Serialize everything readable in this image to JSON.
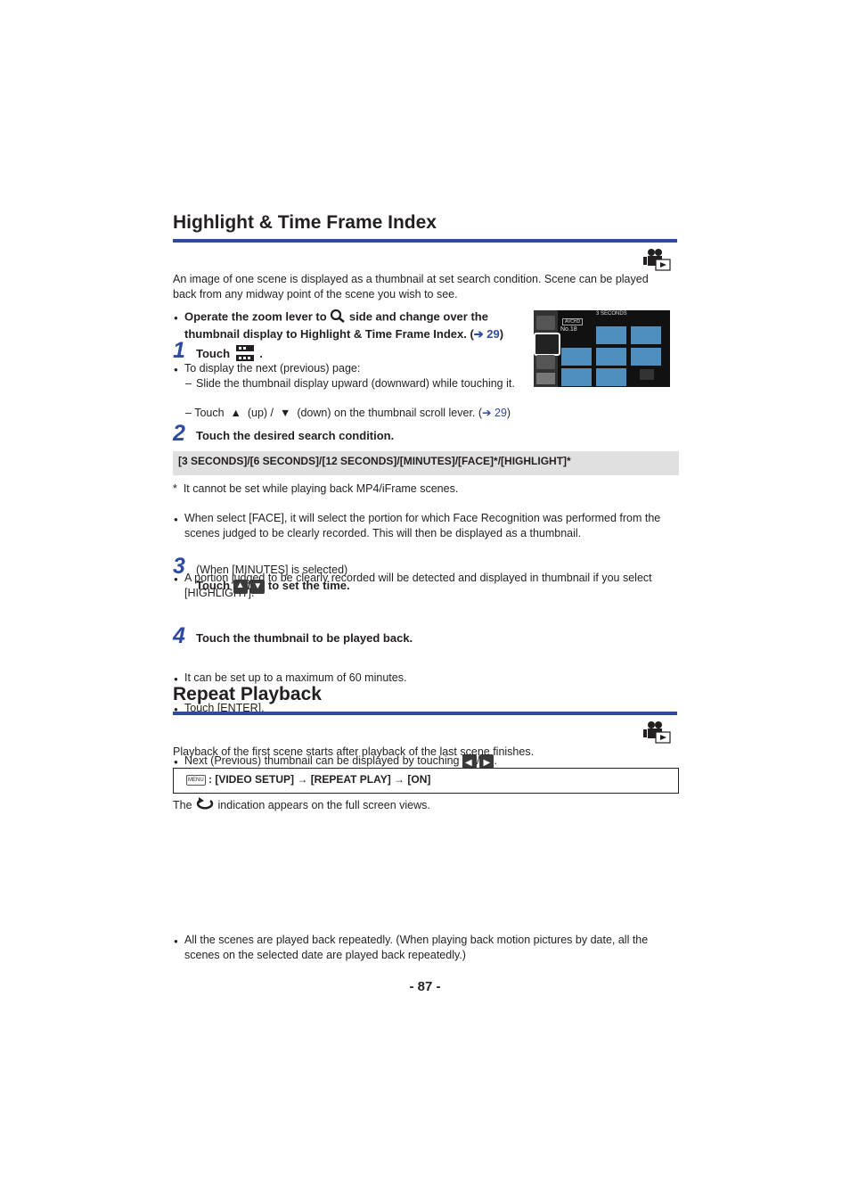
{
  "section1": {
    "title": "Highlight & Time Frame Index",
    "intro": "An image of one scene is displayed as a thumbnail at set search condition. Scene can be played back from any midway point of the scene you wish to see.",
    "prereq_a": "Operate the zoom lever to",
    "prereq_b": "side and change over the",
    "prereq_c": "thumbnail display to Highlight & Time Frame Index. (",
    "prereq_link": "➔ 29",
    "prereq_end": ")",
    "step1": {
      "num": "1",
      "label": "Touch",
      "end": "."
    },
    "step1_bullet": "To display the next (previous) page:",
    "step1_dash1": "Slide the thumbnail display upward (downward) while touching it.",
    "step1_dash2_a": "Touch",
    "step1_dash2_b": "(up) /",
    "step1_dash2_c": "(down) on the thumbnail scroll lever. (",
    "step1_dash2_link": "➔ 29",
    "step1_dash2_end": ")",
    "step2": {
      "num": "2",
      "label": "Touch the desired search condition."
    },
    "options_bar": "[3 SECONDS]/[6 SECONDS]/[12 SECONDS]/[MINUTES]/[FACE]*/[HIGHLIGHT]*",
    "note_star": "It cannot be set while playing back MP4/iFrame scenes.",
    "note1": "When select [FACE], it will select the portion for which Face Recognition was performed from the scenes judged to be clearly recorded. This will then be displayed as a thumbnail.",
    "note2": "A portion judged to be clearly recorded will be detected and displayed in thumbnail if you select [HIGHLIGHT].",
    "step3": {
      "num": "3",
      "sub": "(When [MINUTES] is selected)",
      "label_a": "Touch",
      "label_b": "/",
      "label_c": "to set the time."
    },
    "step3_b1": "It can be set up to a maximum of 60 minutes.",
    "step3_b2": "Touch [ENTER].",
    "step4": {
      "num": "4",
      "label": "Touch the thumbnail to be played back."
    },
    "step4_b1": "Next (Previous) thumbnail can be displayed by touching",
    "step4_b1_sep": "/",
    "step4_b1_end": ".",
    "screen": {
      "header": "3 SECONDS",
      "badge": "AVCHD",
      "scene_no": "No.18"
    }
  },
  "section2": {
    "title": "Repeat Playback",
    "intro": "Playback of the first scene starts after playback of the last scene finishes.",
    "menu_icon": "MENU",
    "menu_path": ": [VIDEO SETUP] → [REPEAT PLAY] → [ON]",
    "indication_a": "The",
    "indication_b": "indication appears on the full screen views.",
    "bullet1": "All the scenes are played back repeatedly. (When playing back motion pictures by date, all the scenes on the selected date are played back repeatedly.)"
  },
  "page_number": "- 87 -",
  "colors": {
    "accent": "#2e4ba0",
    "text": "#231f20",
    "gray_bar": "#e0e0e0"
  }
}
